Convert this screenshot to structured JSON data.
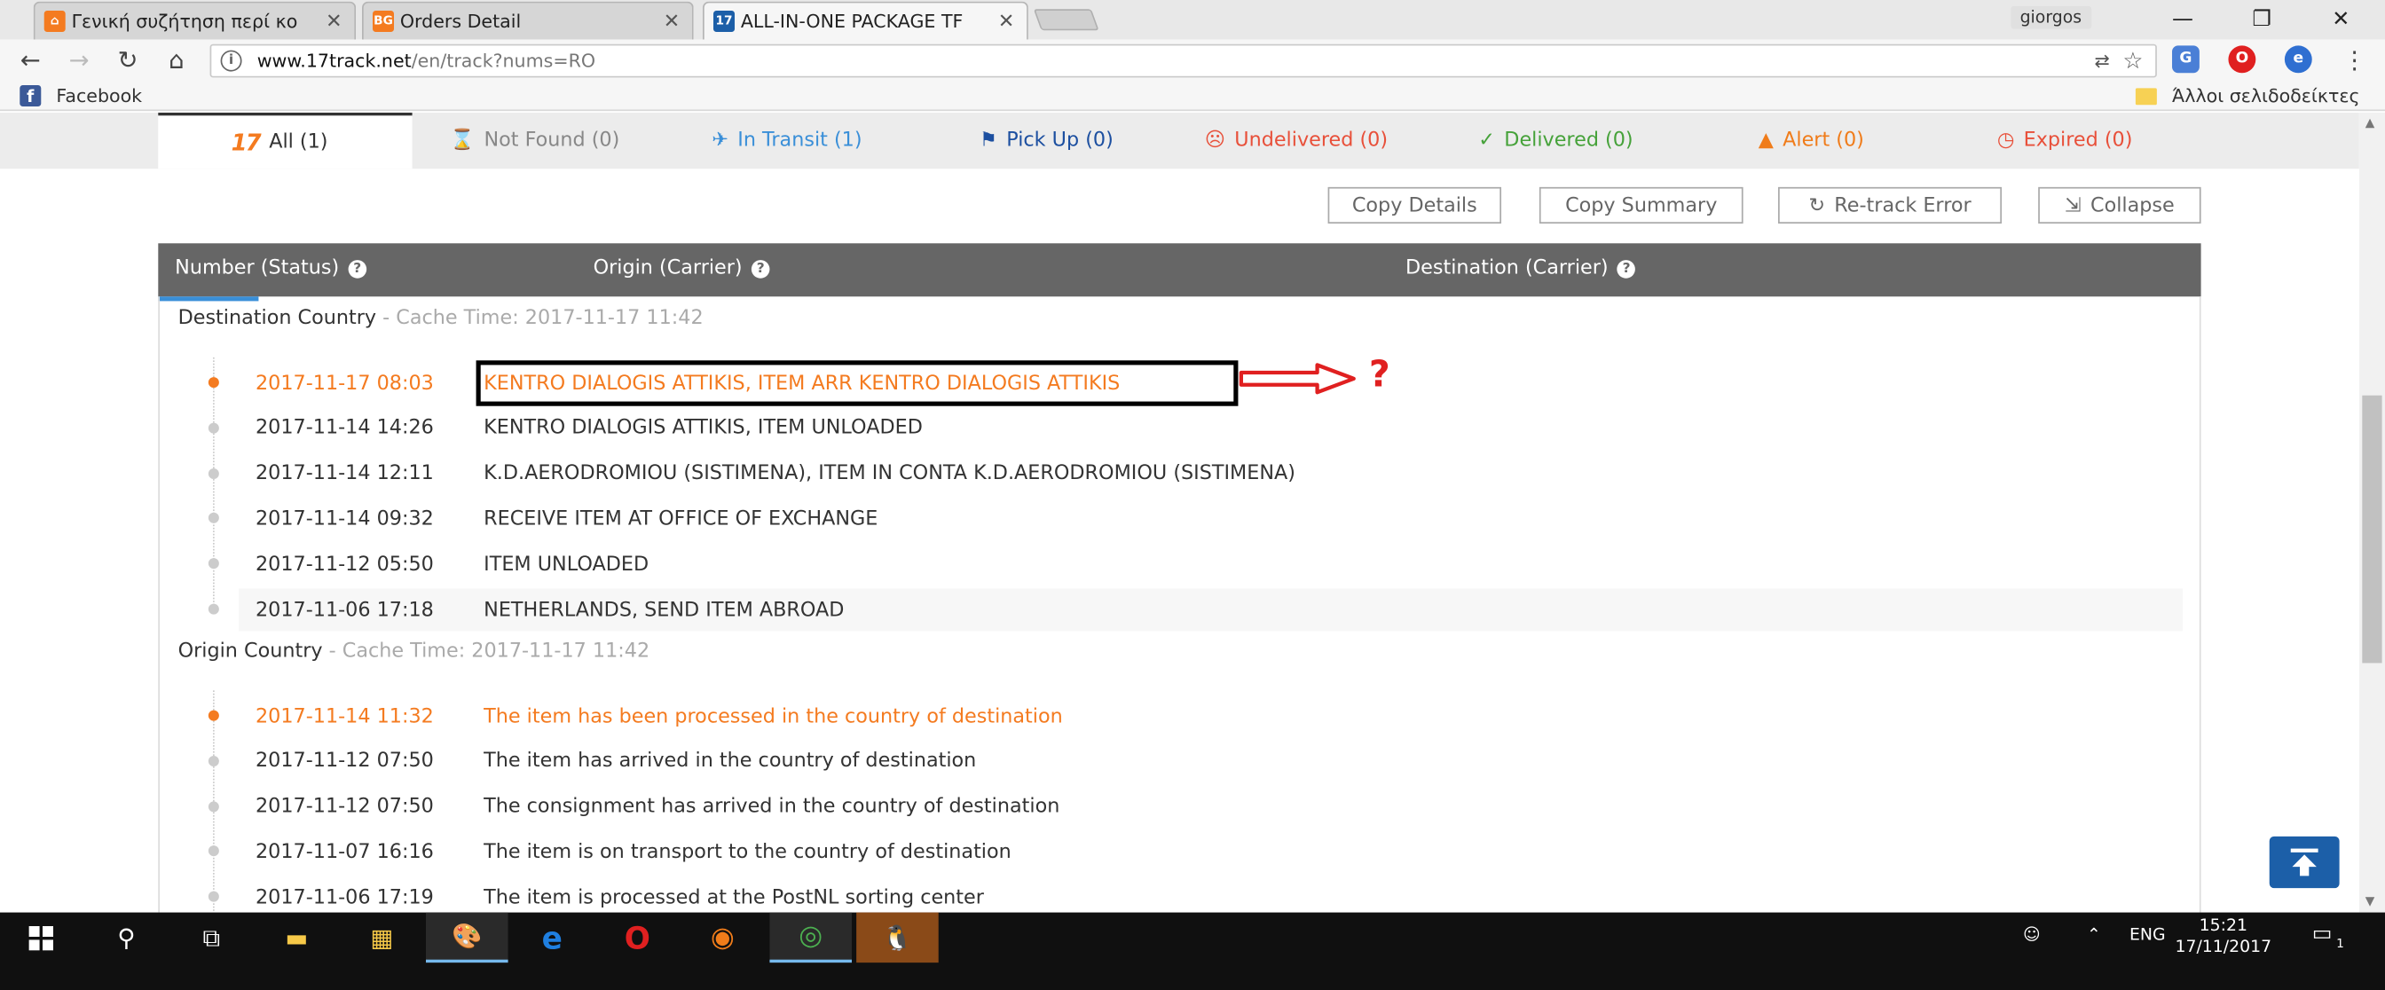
{
  "browser": {
    "tabs": [
      {
        "title": "Γενική συζήτηση περί κο",
        "icon": "home-icon",
        "active": false
      },
      {
        "title": "Orders Detail",
        "icon": "bg-icon",
        "active": false
      },
      {
        "title": "ALL-IN-ONE PACKAGE TF",
        "icon": "17track-icon",
        "active": true
      }
    ],
    "user": "giorgos",
    "favicon_text_bg": "BG",
    "favicon_text_17": "17",
    "url_host": "www.17track.net",
    "url_path": "/en/track?nums=RO",
    "bookmarks": {
      "facebook": "Facebook",
      "other": "Άλλοι σελιδοδείκτες"
    }
  },
  "status_tabs": [
    {
      "label": "All (1)",
      "color": "#333333"
    },
    {
      "label": "Not Found (0)",
      "color": "#888888"
    },
    {
      "label": "In Transit (1)",
      "color": "#3a8fd8"
    },
    {
      "label": "Pick Up (0)",
      "color": "#1c4fa0"
    },
    {
      "label": "Undelivered (0)",
      "color": "#e8503a"
    },
    {
      "label": "Delivered (0)",
      "color": "#46a23a"
    },
    {
      "label": "Alert (0)",
      "color": "#f07c1a"
    },
    {
      "label": "Expired (0)",
      "color": "#e8503a"
    }
  ],
  "logo_text": "17",
  "actions": {
    "copy_details": "Copy Details",
    "copy_summary": "Copy Summary",
    "retrack": "Re-track Error",
    "collapse": "Collapse"
  },
  "table_headers": {
    "number": "Number (Status)",
    "origin": "Origin (Carrier)",
    "destination": "Destination (Carrier)"
  },
  "destination": {
    "title": "Destination Country",
    "cache": " - Cache Time: 2017-11-17 11:42",
    "events": [
      {
        "time": "2017-11-17 08:03",
        "text": "KENTRO DIALOGIS ATTIKIS, ITEM ARR KENTRO DIALOGIS ATTIKIS"
      },
      {
        "time": "2017-11-14 14:26",
        "text": "KENTRO DIALOGIS ATTIKIS, ITEM UNLOADED"
      },
      {
        "time": "2017-11-14 12:11",
        "text": "K.D.AERODROMIOU (SISTIMENA), ITEM IN CONTA K.D.AERODROMIOU (SISTIMENA)"
      },
      {
        "time": "2017-11-14 09:32",
        "text": "RECEIVE ITEM AT OFFICE OF EXCHANGE"
      },
      {
        "time": "2017-11-12 05:50",
        "text": "ITEM UNLOADED"
      },
      {
        "time": "2017-11-06 17:18",
        "text": "NETHERLANDS, SEND ITEM ABROAD"
      }
    ]
  },
  "origin": {
    "title": "Origin Country",
    "cache": " - Cache Time: 2017-11-17 11:42",
    "events": [
      {
        "time": "2017-11-14 11:32",
        "text": "The item has been processed in the country of destination"
      },
      {
        "time": "2017-11-12 07:50",
        "text": "The item has arrived in the country of destination"
      },
      {
        "time": "2017-11-12 07:50",
        "text": "The consignment has arrived in the country of destination"
      },
      {
        "time": "2017-11-07 16:16",
        "text": "The item is on transport to the country of destination"
      },
      {
        "time": "2017-11-06 17:19",
        "text": "The item is processed at the PostNL sorting center"
      }
    ]
  },
  "annotation": {
    "mark": "?"
  },
  "taskbar": {
    "lang": "ENG",
    "time": "15:21",
    "date": "17/11/2017",
    "notif_count": "1"
  },
  "colors": {
    "accent_orange": "#f47b20",
    "header_gray": "#666666",
    "annot_red": "#e02020"
  }
}
